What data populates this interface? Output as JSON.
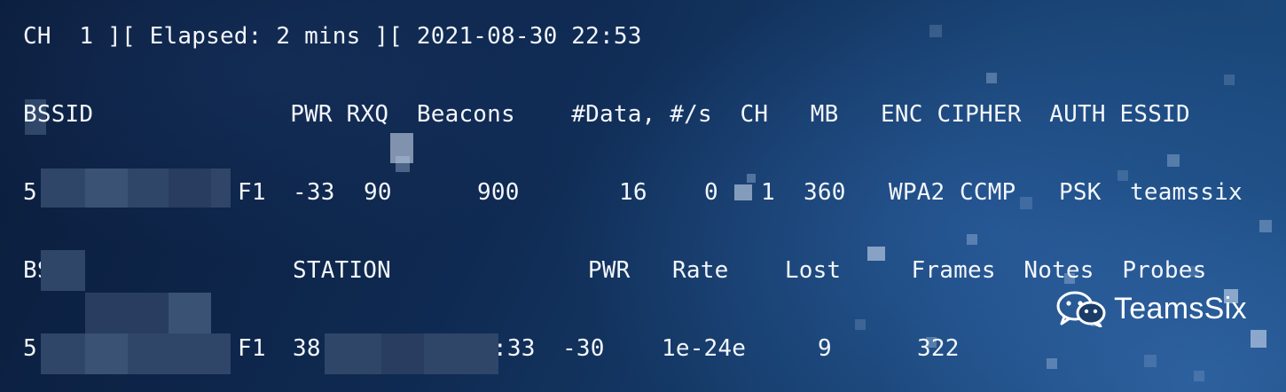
{
  "header": {
    "status_line": "CH  1 ][ Elapsed: 2 mins ][ 2021-08-30 22:53"
  },
  "ap_table": {
    "columns": [
      "BSSID",
      "PWR",
      "RXQ",
      "Beacons",
      "#Data, #/s",
      "CH",
      "MB",
      "ENC",
      "CIPHER",
      "AUTH",
      "ESSID"
    ],
    "header_line": "BSSID              PWR RXQ  Beacons    #Data, #/s  CH   MB   ENC CIPHER  AUTH ESSID",
    "rows": [
      {
        "bssid_start": "5",
        "bssid_end": "F1",
        "pwr": "-33",
        "rxq": "90",
        "beacons": "900",
        "data": "16",
        "per_sec": "0",
        "ch": "1",
        "mb": "360",
        "enc": "WPA2",
        "cipher": "CCMP",
        "auth": "PSK",
        "essid": "teamssix"
      }
    ]
  },
  "station_table": {
    "columns": [
      "BSSID",
      "STATION",
      "PWR",
      "Rate",
      "Lost",
      "Frames",
      "Notes",
      "Probes"
    ],
    "header_bssid": "BS",
    "header_rest": "STATION              PWR   Rate    Lost     Frames  Notes  Probes",
    "rows": [
      {
        "bssid_start": "5",
        "bssid_end": "F1",
        "station_start": "38",
        "station_end": ":33",
        "pwr": "-30",
        "rate": "1e-24e",
        "lost": "9",
        "frames": "322"
      }
    ]
  },
  "watermark": {
    "icon": "wechat-icon",
    "text": "TeamsSix"
  }
}
